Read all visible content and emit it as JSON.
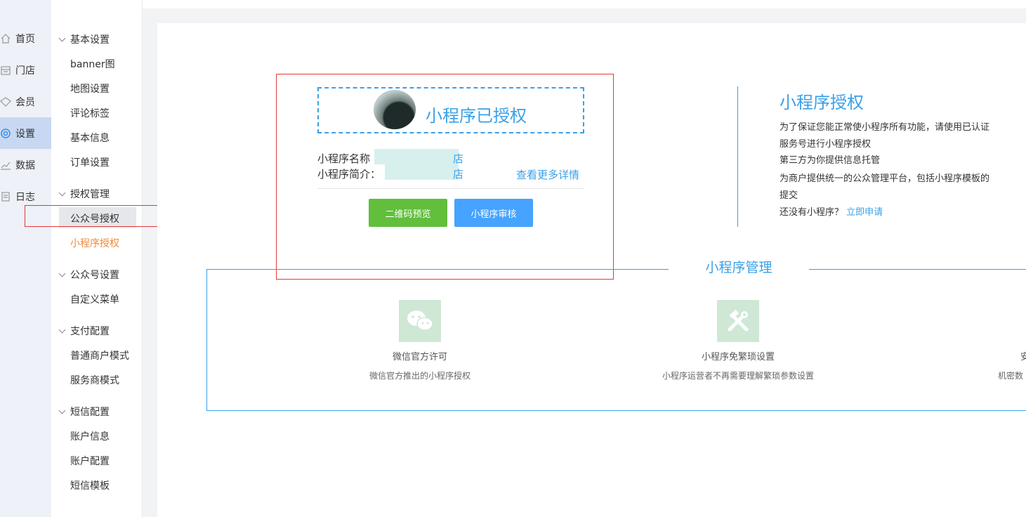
{
  "nav": {
    "items": [
      {
        "label": "首页",
        "icon": "home-icon"
      },
      {
        "label": "门店",
        "icon": "store-icon"
      },
      {
        "label": "会员",
        "icon": "member-icon"
      },
      {
        "label": "设置",
        "icon": "settings-icon",
        "active": true
      },
      {
        "label": "数据",
        "icon": "chart-icon"
      },
      {
        "label": "日志",
        "icon": "log-icon"
      }
    ]
  },
  "submenu": {
    "groups": [
      {
        "title": "基本设置",
        "items": [
          "banner图",
          "地图设置",
          "评论标签",
          "基本信息",
          "订单设置"
        ]
      },
      {
        "title": "授权管理",
        "items": [
          "公众号授权",
          "小程序授权"
        ]
      },
      {
        "title": "公众号设置",
        "items": [
          "自定义菜单"
        ]
      },
      {
        "title": "支付配置",
        "items": [
          "普通商户模式",
          "服务商模式"
        ]
      },
      {
        "title": "短信配置",
        "items": [
          "账户信息",
          "账户配置",
          "短信模板"
        ]
      }
    ],
    "selected": "公众号授权",
    "current_page": "小程序授权"
  },
  "auth_card": {
    "title": "小程序已授权",
    "name_label": "小程序名称",
    "name_tail": "店",
    "intro_label": "小程序简介：",
    "intro_tail": "店",
    "more_link": "查看更多详情",
    "btn_qrcode": "二维码预览",
    "btn_review": "小程序审核"
  },
  "right_info": {
    "title": "小程序授权",
    "line1": "为了保证您能正常使小程序所有功能，请使用已认证服务号进行小程序授权",
    "line2": "第三方为你提供信息托管",
    "line3": "为商户提供统一的公众管理平台，包括小程序模板的提交",
    "line4_prefix": "还没有小程序？",
    "line4_link": "立即申请"
  },
  "management": {
    "title": "小程序管理",
    "features": [
      {
        "title": "微信官方许可",
        "desc": "微信官方推出的小程序授权",
        "icon": "wechat-icon"
      },
      {
        "title": "小程序免繁琐设置",
        "desc": "小程序运营者不再需要理解繁琐参数设置",
        "icon": "tools-icon"
      },
      {
        "title": "安",
        "desc": "机密数",
        "icon": ""
      }
    ]
  },
  "colors": {
    "accent": "#3aa0e8",
    "green": "#61bf3c",
    "blue_btn": "#46a3ff",
    "orange": "#f08a3c",
    "highlight_red": "#e23b3b"
  }
}
